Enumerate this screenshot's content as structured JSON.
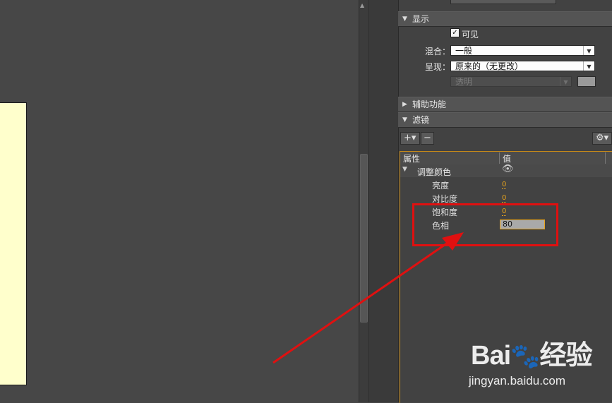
{
  "top_field": {
    "label_partial": "混合：",
    "value_partial": "一般"
  },
  "sections": {
    "display": {
      "title": "显示"
    },
    "accessibility": {
      "title": "辅助功能"
    },
    "filters": {
      "title": "滤镜"
    }
  },
  "display": {
    "visible_label": "可见",
    "blend_label": "混合：",
    "blend_value": "一般",
    "render_label": "呈现：",
    "render_value": "原来的（无更改）",
    "transparent_value": "透明"
  },
  "filters": {
    "add_button": "+▾",
    "remove_button": "−",
    "gear_button": "⚙▾",
    "columns": {
      "property": "属性",
      "value": "值"
    },
    "group": {
      "name": "调整颜色"
    },
    "rows": [
      {
        "name": "亮度",
        "value": "0"
      },
      {
        "name": "对比度",
        "value": "0"
      },
      {
        "name": "饱和度",
        "value": "0"
      },
      {
        "name": "色相",
        "value": "80"
      }
    ]
  },
  "watermark": {
    "logo": "Bai du 经验",
    "url": "jingyan.baidu.com"
  },
  "colors": {
    "accent_orange": "#e8a41c",
    "annotation_red": "#e01010",
    "canvas": "#ffffcc"
  }
}
